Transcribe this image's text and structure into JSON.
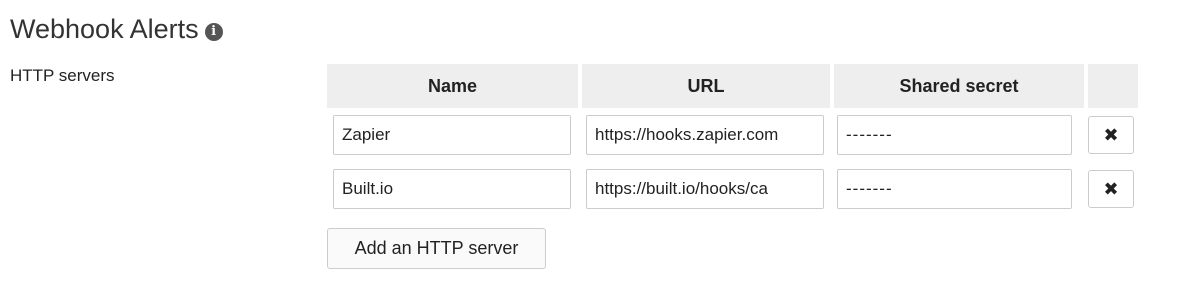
{
  "section": {
    "title": "Webhook Alerts",
    "info_icon": "info-icon",
    "info_glyph": "i"
  },
  "http_servers": {
    "label": "HTTP servers",
    "columns": [
      "Name",
      "URL",
      "Shared secret",
      ""
    ],
    "rows": [
      {
        "name": "Zapier",
        "url": "https://hooks.zapier.com",
        "secret": "-------",
        "remove_icon": "close-icon",
        "remove_glyph": "✖"
      },
      {
        "name": "Built.io",
        "url": "https://built.io/hooks/ca",
        "secret": "-------",
        "remove_icon": "close-icon",
        "remove_glyph": "✖"
      }
    ],
    "add_button_label": "Add an HTTP server"
  }
}
